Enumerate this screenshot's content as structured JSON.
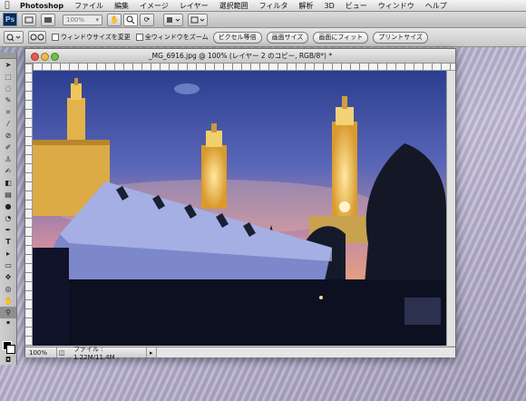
{
  "menubar": {
    "apple": "",
    "app": "Photoshop",
    "items": [
      "ファイル",
      "編集",
      "イメージ",
      "レイヤー",
      "選択範囲",
      "フィルタ",
      "解析",
      "3D",
      "ビュー",
      "ウィンドウ",
      "ヘルプ"
    ]
  },
  "appbar": {
    "logo": "Ps",
    "zoom": "100%"
  },
  "options": {
    "chk_resize": "ウィンドウサイズを変更",
    "chk_all": "全ウィンドウをズーム",
    "btn_pixel": "ピクセル等倍",
    "btn_screen": "画面サイズ",
    "btn_fit": "画面にフィット",
    "btn_print": "プリントサイズ"
  },
  "document": {
    "title": "_MG_6916.jpg @ 100% (レイヤー 2 のコピー, RGB/8*) *",
    "status_zoom": "100%",
    "status_info": "ファイル : 1.22M/11.4M"
  },
  "colors": {
    "close": "#ec5b53",
    "minimize": "#f2b94a",
    "zoom": "#6cc24a"
  },
  "icons": [
    "apple-icon",
    "ps-logo-icon",
    "document-icon",
    "hand-icon",
    "zoom-icon",
    "rotate-icon",
    "arrange-icon",
    "screen-mode-icon"
  ]
}
